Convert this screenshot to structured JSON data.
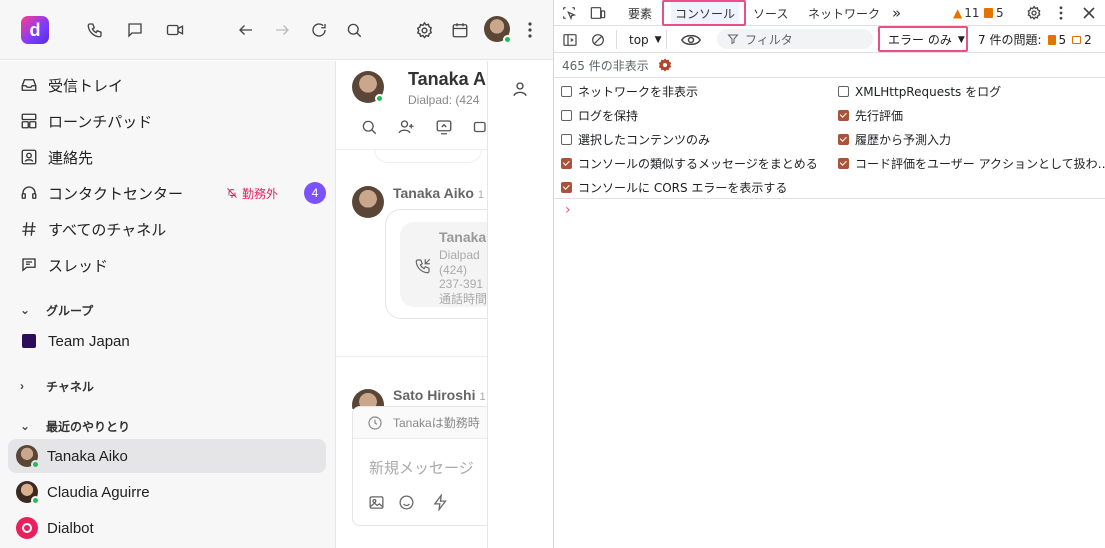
{
  "topbar": {
    "logo_letter": "d",
    "icons": [
      "phone-icon",
      "chat-icon",
      "video-icon",
      "back-icon",
      "forward-icon",
      "refresh-icon",
      "search-icon",
      "settings-icon",
      "calendar-icon",
      "avatar",
      "more-icon"
    ]
  },
  "sidebar": {
    "items": [
      {
        "label": "受信トレイ",
        "icon": "inbox-icon"
      },
      {
        "label": "ローンチパッド",
        "icon": "launchpad-icon"
      },
      {
        "label": "連絡先",
        "icon": "contacts-icon"
      },
      {
        "label": "コンタクトセンター",
        "icon": "headset-icon",
        "status": "勤務外",
        "count": "4"
      },
      {
        "label": "すべてのチャネル",
        "icon": "hash-icon"
      },
      {
        "label": "スレッド",
        "icon": "thread-icon"
      }
    ],
    "groups_header": "グループ",
    "groups": [
      {
        "label": "Team Japan",
        "color": "#2a0e5c"
      }
    ],
    "channels_header": "チャネル",
    "recent_header": "最近のやりとり",
    "recent": [
      {
        "label": "Tanaka Aiko",
        "selected": true
      },
      {
        "label": "Claudia Aguirre",
        "selected": false
      },
      {
        "label": "Dialbot",
        "selected": false
      }
    ]
  },
  "chat": {
    "header_name": "Tanaka A",
    "header_sub": "Dialpad: (424",
    "message1_author": "Tanaka Aiko",
    "message1_time": "1",
    "call_card_name": "Tanaka",
    "call_card_line1": "Dialpad",
    "call_card_line2": "(424)",
    "call_card_line3": "237-391",
    "call_card_line4": "通話時間",
    "message2_author": "Sato Hiroshi",
    "message2_time": "1",
    "offhours_notice": "Tanakaは勤務時",
    "composer_placeholder": "新規メッセージ"
  },
  "devtools": {
    "tabs": [
      {
        "label": "要素",
        "active": false
      },
      {
        "label": "コンソール",
        "active": true
      },
      {
        "label": "ソース",
        "active": false
      },
      {
        "label": "ネットワーク",
        "active": false
      }
    ],
    "more_tabs": "»",
    "warnings_count": "11",
    "errors_count": "5",
    "context": "top",
    "filter_placeholder": "フィルタ",
    "level": "エラー のみ",
    "issues_label": "7 件の問題:",
    "issues_errors": "5",
    "issues_info": "2",
    "hidden_count": "465 件の非表示",
    "options_left": [
      {
        "label": "ネットワークを非表示",
        "checked": false
      },
      {
        "label": "ログを保持",
        "checked": false
      },
      {
        "label": "選択したコンテンツのみ",
        "checked": false
      },
      {
        "label": "コンソールの類似するメッセージをまとめる",
        "checked": true
      },
      {
        "label": "コンソールに CORS エラーを表示する",
        "checked": true
      }
    ],
    "options_right": [
      {
        "label": "XMLHttpRequests をログ",
        "checked": false
      },
      {
        "label": "先行評価",
        "checked": true
      },
      {
        "label": "履歴から予測入力",
        "checked": true
      },
      {
        "label": "コード評価をユーザー アクションとして扱わ…",
        "checked": true
      }
    ],
    "prompt": "›",
    "accent_color": "#e8508a"
  }
}
